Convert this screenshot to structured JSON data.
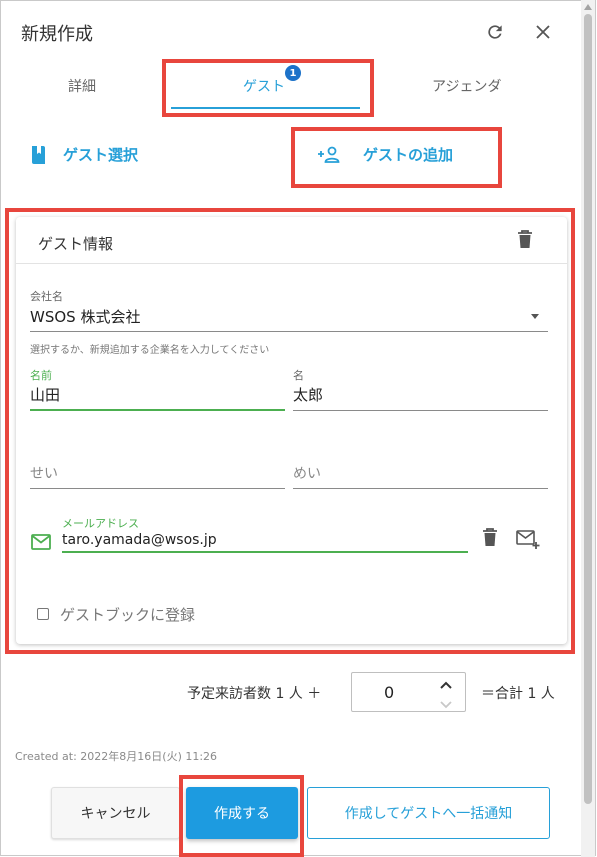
{
  "dialog": {
    "title": "新規作成"
  },
  "tabs": [
    {
      "label": "詳細"
    },
    {
      "label": "ゲスト",
      "badge": "1"
    },
    {
      "label": "アジェンダ"
    }
  ],
  "actions": {
    "select_guest": "ゲスト選択",
    "add_guest": "ゲストの追加"
  },
  "guest_card": {
    "title": "ゲスト情報",
    "company": {
      "label": "会社名",
      "value": "WSOS 株式会社",
      "hint": "選択するか、新規追加する企業名を入力してください"
    },
    "last_name": {
      "label": "名前",
      "value": "山田"
    },
    "first_name": {
      "label": "名",
      "value": "太郎"
    },
    "last_name_kana": {
      "placeholder": "せい"
    },
    "first_name_kana": {
      "placeholder": "めい"
    },
    "email": {
      "label": "メールアドレス",
      "value": "taro.yamada@wsos.jp"
    },
    "guestbook_label": "ゲストブックに登録"
  },
  "visitors": {
    "prefix": "予定来訪者数 1 人 ＋",
    "value": "0",
    "total": "＝合計 1 人"
  },
  "created_at": "Created at: 2022年8月16日(火) 11:26",
  "buttons": {
    "cancel": "キャンセル",
    "create": "作成する",
    "create_notify": "作成してゲストへ一括通知"
  },
  "colors": {
    "accent": "#27a0d8",
    "badge": "#1c72c9",
    "valid_green": "#4caf50",
    "highlight_red": "#e8463d",
    "primary_button": "#1d9be0"
  }
}
